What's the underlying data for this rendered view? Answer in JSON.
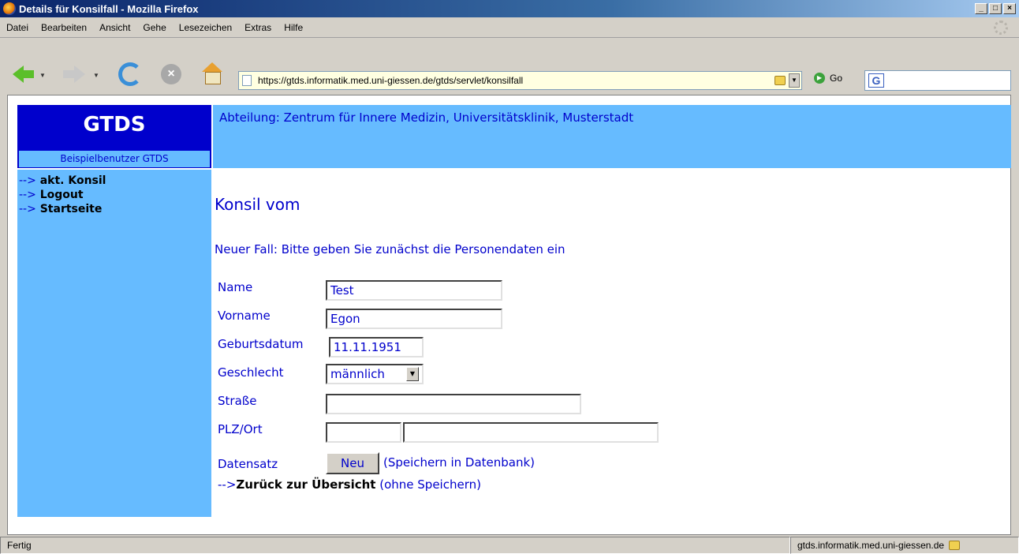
{
  "window": {
    "title": "Details für Konsilfall - Mozilla Firefox",
    "min": "_",
    "max": "□",
    "close": "×"
  },
  "menu": {
    "items": [
      "Datei",
      "Bearbeiten",
      "Ansicht",
      "Gehe",
      "Lesezeichen",
      "Extras",
      "Hilfe"
    ]
  },
  "toolbar": {
    "url": "https://gtds.informatik.med.uni-giessen.de/gtds/servlet/konsilfall",
    "go_label": "Go",
    "search_value": ""
  },
  "page": {
    "logo_title": "GTDS",
    "user": "Beispielbenutzer GTDS",
    "department": "Abteilung: Zentrum für Innere Medizin, Universitätsklinik, Musterstadt",
    "sidebar": [
      {
        "arrow": "-->",
        "label": "akt. Konsil"
      },
      {
        "arrow": "-->",
        "label": "Logout"
      },
      {
        "arrow": "-->",
        "label": "Startseite"
      }
    ],
    "heading": "Konsil vom",
    "intro": "Neuer Fall: Bitte geben Sie zunächst die Personendaten ein",
    "form": {
      "name_label": "Name",
      "name_value": "Test",
      "vorname_label": "Vorname",
      "vorname_value": "Egon",
      "geburtsdatum_label": "Geburtsdatum",
      "geburtsdatum_value": "11.11.1951",
      "geschlecht_label": "Geschlecht",
      "geschlecht_value": "männlich",
      "strasse_label": "Straße",
      "strasse_value": "",
      "plzort_label": "PLZ/Ort",
      "plz_value": "",
      "ort_value": "",
      "datensatz_label": "Datensatz",
      "neu_button": "Neu",
      "save_note": "(Speichern in Datenbank)",
      "back_arrow": "-->",
      "back_link": "Zurück zur Übersicht",
      "back_note": "(ohne Speichern)"
    }
  },
  "status": {
    "text": "Fertig",
    "host": "gtds.informatik.med.uni-giessen.de"
  }
}
